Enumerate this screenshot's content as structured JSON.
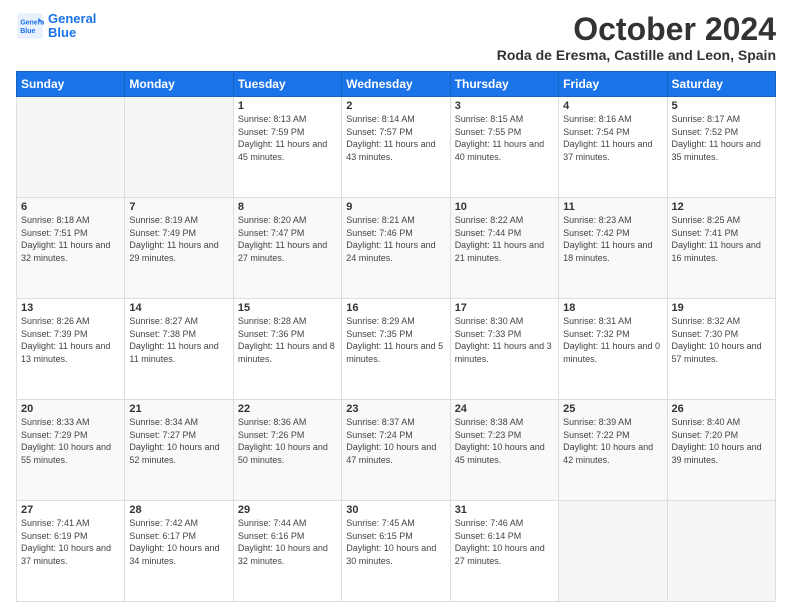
{
  "header": {
    "logo_line1": "General",
    "logo_line2": "Blue",
    "title": "October 2024",
    "subtitle": "Roda de Eresma, Castille and Leon, Spain"
  },
  "weekdays": [
    "Sunday",
    "Monday",
    "Tuesday",
    "Wednesday",
    "Thursday",
    "Friday",
    "Saturday"
  ],
  "weeks": [
    [
      {
        "day": "",
        "sunrise": "",
        "sunset": "",
        "daylight": ""
      },
      {
        "day": "",
        "sunrise": "",
        "sunset": "",
        "daylight": ""
      },
      {
        "day": "1",
        "sunrise": "Sunrise: 8:13 AM",
        "sunset": "Sunset: 7:59 PM",
        "daylight": "Daylight: 11 hours and 45 minutes."
      },
      {
        "day": "2",
        "sunrise": "Sunrise: 8:14 AM",
        "sunset": "Sunset: 7:57 PM",
        "daylight": "Daylight: 11 hours and 43 minutes."
      },
      {
        "day": "3",
        "sunrise": "Sunrise: 8:15 AM",
        "sunset": "Sunset: 7:55 PM",
        "daylight": "Daylight: 11 hours and 40 minutes."
      },
      {
        "day": "4",
        "sunrise": "Sunrise: 8:16 AM",
        "sunset": "Sunset: 7:54 PM",
        "daylight": "Daylight: 11 hours and 37 minutes."
      },
      {
        "day": "5",
        "sunrise": "Sunrise: 8:17 AM",
        "sunset": "Sunset: 7:52 PM",
        "daylight": "Daylight: 11 hours and 35 minutes."
      }
    ],
    [
      {
        "day": "6",
        "sunrise": "Sunrise: 8:18 AM",
        "sunset": "Sunset: 7:51 PM",
        "daylight": "Daylight: 11 hours and 32 minutes."
      },
      {
        "day": "7",
        "sunrise": "Sunrise: 8:19 AM",
        "sunset": "Sunset: 7:49 PM",
        "daylight": "Daylight: 11 hours and 29 minutes."
      },
      {
        "day": "8",
        "sunrise": "Sunrise: 8:20 AM",
        "sunset": "Sunset: 7:47 PM",
        "daylight": "Daylight: 11 hours and 27 minutes."
      },
      {
        "day": "9",
        "sunrise": "Sunrise: 8:21 AM",
        "sunset": "Sunset: 7:46 PM",
        "daylight": "Daylight: 11 hours and 24 minutes."
      },
      {
        "day": "10",
        "sunrise": "Sunrise: 8:22 AM",
        "sunset": "Sunset: 7:44 PM",
        "daylight": "Daylight: 11 hours and 21 minutes."
      },
      {
        "day": "11",
        "sunrise": "Sunrise: 8:23 AM",
        "sunset": "Sunset: 7:42 PM",
        "daylight": "Daylight: 11 hours and 18 minutes."
      },
      {
        "day": "12",
        "sunrise": "Sunrise: 8:25 AM",
        "sunset": "Sunset: 7:41 PM",
        "daylight": "Daylight: 11 hours and 16 minutes."
      }
    ],
    [
      {
        "day": "13",
        "sunrise": "Sunrise: 8:26 AM",
        "sunset": "Sunset: 7:39 PM",
        "daylight": "Daylight: 11 hours and 13 minutes."
      },
      {
        "day": "14",
        "sunrise": "Sunrise: 8:27 AM",
        "sunset": "Sunset: 7:38 PM",
        "daylight": "Daylight: 11 hours and 11 minutes."
      },
      {
        "day": "15",
        "sunrise": "Sunrise: 8:28 AM",
        "sunset": "Sunset: 7:36 PM",
        "daylight": "Daylight: 11 hours and 8 minutes."
      },
      {
        "day": "16",
        "sunrise": "Sunrise: 8:29 AM",
        "sunset": "Sunset: 7:35 PM",
        "daylight": "Daylight: 11 hours and 5 minutes."
      },
      {
        "day": "17",
        "sunrise": "Sunrise: 8:30 AM",
        "sunset": "Sunset: 7:33 PM",
        "daylight": "Daylight: 11 hours and 3 minutes."
      },
      {
        "day": "18",
        "sunrise": "Sunrise: 8:31 AM",
        "sunset": "Sunset: 7:32 PM",
        "daylight": "Daylight: 11 hours and 0 minutes."
      },
      {
        "day": "19",
        "sunrise": "Sunrise: 8:32 AM",
        "sunset": "Sunset: 7:30 PM",
        "daylight": "Daylight: 10 hours and 57 minutes."
      }
    ],
    [
      {
        "day": "20",
        "sunrise": "Sunrise: 8:33 AM",
        "sunset": "Sunset: 7:29 PM",
        "daylight": "Daylight: 10 hours and 55 minutes."
      },
      {
        "day": "21",
        "sunrise": "Sunrise: 8:34 AM",
        "sunset": "Sunset: 7:27 PM",
        "daylight": "Daylight: 10 hours and 52 minutes."
      },
      {
        "day": "22",
        "sunrise": "Sunrise: 8:36 AM",
        "sunset": "Sunset: 7:26 PM",
        "daylight": "Daylight: 10 hours and 50 minutes."
      },
      {
        "day": "23",
        "sunrise": "Sunrise: 8:37 AM",
        "sunset": "Sunset: 7:24 PM",
        "daylight": "Daylight: 10 hours and 47 minutes."
      },
      {
        "day": "24",
        "sunrise": "Sunrise: 8:38 AM",
        "sunset": "Sunset: 7:23 PM",
        "daylight": "Daylight: 10 hours and 45 minutes."
      },
      {
        "day": "25",
        "sunrise": "Sunrise: 8:39 AM",
        "sunset": "Sunset: 7:22 PM",
        "daylight": "Daylight: 10 hours and 42 minutes."
      },
      {
        "day": "26",
        "sunrise": "Sunrise: 8:40 AM",
        "sunset": "Sunset: 7:20 PM",
        "daylight": "Daylight: 10 hours and 39 minutes."
      }
    ],
    [
      {
        "day": "27",
        "sunrise": "Sunrise: 7:41 AM",
        "sunset": "Sunset: 6:19 PM",
        "daylight": "Daylight: 10 hours and 37 minutes."
      },
      {
        "day": "28",
        "sunrise": "Sunrise: 7:42 AM",
        "sunset": "Sunset: 6:17 PM",
        "daylight": "Daylight: 10 hours and 34 minutes."
      },
      {
        "day": "29",
        "sunrise": "Sunrise: 7:44 AM",
        "sunset": "Sunset: 6:16 PM",
        "daylight": "Daylight: 10 hours and 32 minutes."
      },
      {
        "day": "30",
        "sunrise": "Sunrise: 7:45 AM",
        "sunset": "Sunset: 6:15 PM",
        "daylight": "Daylight: 10 hours and 30 minutes."
      },
      {
        "day": "31",
        "sunrise": "Sunrise: 7:46 AM",
        "sunset": "Sunset: 6:14 PM",
        "daylight": "Daylight: 10 hours and 27 minutes."
      },
      {
        "day": "",
        "sunrise": "",
        "sunset": "",
        "daylight": ""
      },
      {
        "day": "",
        "sunrise": "",
        "sunset": "",
        "daylight": ""
      }
    ]
  ]
}
